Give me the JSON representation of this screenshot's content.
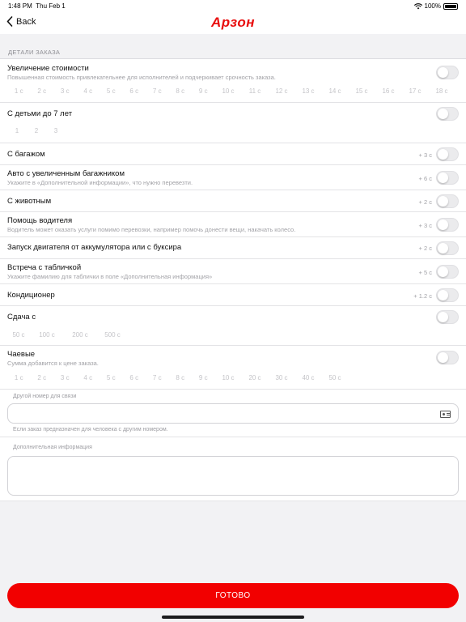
{
  "status_bar": {
    "time": "1:48 PM",
    "date": "Thu Feb 1",
    "battery": "100%"
  },
  "nav": {
    "back_label": "Back",
    "logo": "Арзон"
  },
  "section_header": "ДЕТАЛИ ЗАКАЗА",
  "rows": {
    "price_increase": {
      "title": "Увеличение стоимости",
      "subtitle": "Повышенная стоимость привлекательнее для исполнителей и подчеркивает срочность заказа.",
      "chips": [
        "1 с",
        "2 с",
        "3 с",
        "4 с",
        "5 с",
        "6 с",
        "7 с",
        "8 с",
        "9 с",
        "10 с",
        "11 с",
        "12 с",
        "13 с",
        "14 с",
        "15 с",
        "16 с",
        "17 с",
        "18 с"
      ]
    },
    "children": {
      "title": "С детьми до 7 лет",
      "chips": [
        "1",
        "2",
        "3"
      ]
    },
    "luggage": {
      "title": "С багажом",
      "price": "+ 3 с"
    },
    "big_trunk": {
      "title": "Авто с увеличенным багажником",
      "subtitle": "Укажите в «Дополнительной информации», что нужно перевезти.",
      "price": "+ 6 с"
    },
    "animal": {
      "title": "С животным",
      "price": "+ 2 с"
    },
    "driver_help": {
      "title": "Помощь водителя",
      "subtitle": "Водитель может оказать услуги помимо перевозки, например помочь донести вещи, накачать колесо.",
      "price": "+ 3 с"
    },
    "engine_start": {
      "title": "Запуск двигателя от аккумулятора или с буксира",
      "price": "+ 2 с"
    },
    "sign_meeting": {
      "title": "Встреча с табличкой",
      "subtitle": "Укажите фамилию для таблички в поле «Дополнительная информация»",
      "price": "+ 5 с"
    },
    "ac": {
      "title": "Кондиционер",
      "price": "+ 1.2 с"
    },
    "change": {
      "title": "Сдача с",
      "chips": [
        "50 с",
        "100 с",
        "200 с",
        "500 с"
      ]
    },
    "tips": {
      "title": "Чаевые",
      "subtitle": "Сумма добавится к цене заказа.",
      "chips": [
        "1 с",
        "2 с",
        "3 с",
        "4 с",
        "5 с",
        "6 с",
        "7 с",
        "8 с",
        "9 с",
        "10 с",
        "20 с",
        "30 с",
        "40 с",
        "50 с"
      ]
    }
  },
  "other_phone": {
    "label": "Другой номер для связи",
    "value": "",
    "hint": "Если заказ предназначен для человека с другим номером."
  },
  "extra_info": {
    "label": "Дополнительная информация",
    "value": ""
  },
  "done_button": "ГОТОВО",
  "colors": {
    "accent": "#f20000",
    "toggle_off": "#ebebed",
    "muted_text": "#a2a2a7"
  }
}
